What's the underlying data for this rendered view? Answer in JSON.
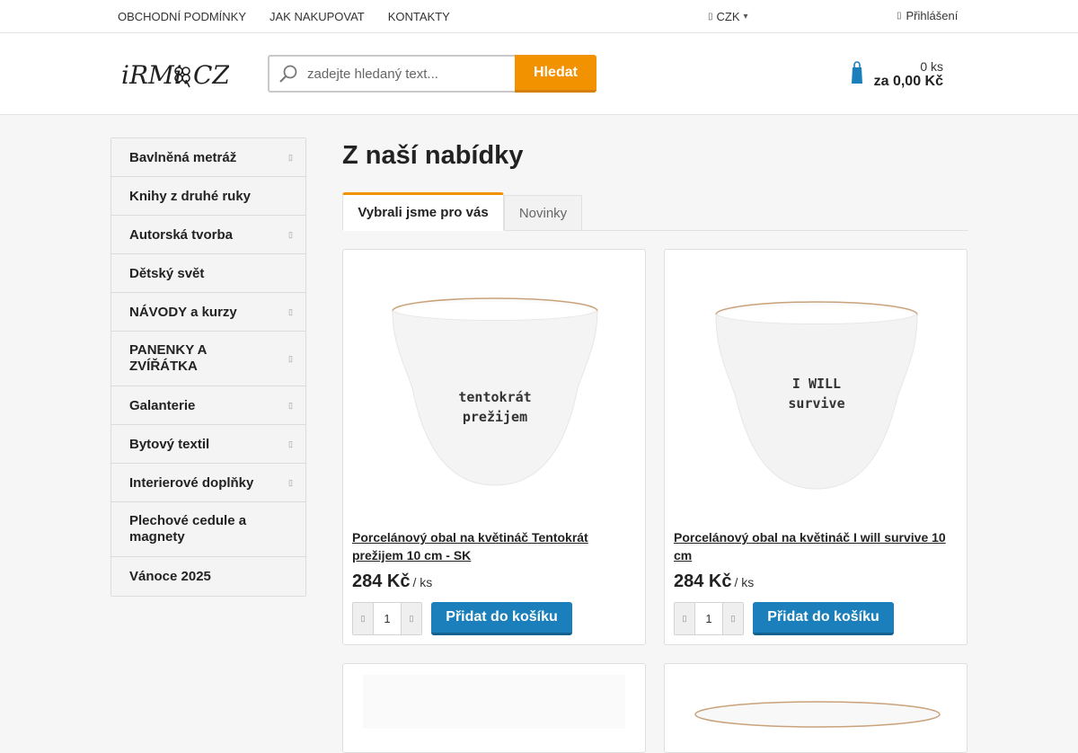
{
  "topbar": {
    "menu": [
      "OBCHODNÍ PODMÍNKY",
      "JAK NAKUPOVAT",
      "KONTAKTY"
    ],
    "currency": "CZK",
    "login": "Přihlášení"
  },
  "header": {
    "logo_text": "iRMi.CZ",
    "search_placeholder": "zadejte hledaný text...",
    "search_button": "Hledat",
    "cart_qty": "0 ks",
    "cart_sum": "za 0,00 Kč"
  },
  "sidebar": {
    "items": [
      {
        "label": "Bavlněná metráž",
        "has_children": true
      },
      {
        "label": "Knihy z druhé ruky",
        "has_children": false
      },
      {
        "label": "Autorská tvorba",
        "has_children": true
      },
      {
        "label": "Dětský svět",
        "has_children": false
      },
      {
        "label": "NÁVODY a kurzy",
        "has_children": true
      },
      {
        "label": "PANENKY A ZVÍŘÁTKA",
        "has_children": true
      },
      {
        "label": "Galanterie",
        "has_children": true
      },
      {
        "label": "Bytový textil",
        "has_children": true
      },
      {
        "label": "Interierové doplňky",
        "has_children": true
      },
      {
        "label": "Plechové cedule a magnety",
        "has_children": false
      },
      {
        "label": "Vánoce 2025",
        "has_children": false
      }
    ]
  },
  "main": {
    "title": "Z naší nabídky",
    "tabs": [
      "Vybrali jsme pro vás",
      "Novinky"
    ],
    "products": [
      {
        "name": "Porcelánový obal na květináč Tentokrát prežijem 10 cm - SK",
        "price": "284 Kč",
        "unit": "/ ks",
        "qty": "1",
        "add_label": "Přidat do košíku",
        "print_line1": "tentokrát",
        "print_line2": "prežijem"
      },
      {
        "name": "Porcelánový obal na květináč I will survive 10 cm",
        "price": "284 Kč",
        "unit": "/ ks",
        "qty": "1",
        "add_label": "Přidat do košíku",
        "print_line1": "I WILL",
        "print_line2": "survive"
      }
    ]
  },
  "colors": {
    "accent": "#f39200",
    "button_blue": "#1a7fba",
    "cup_rim": "#c9a27a"
  }
}
